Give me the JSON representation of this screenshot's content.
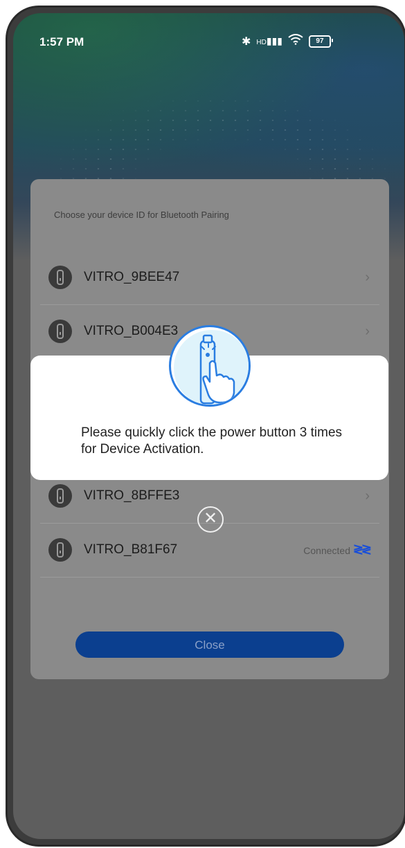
{
  "status_bar": {
    "time": "1:57 PM",
    "bluetooth_icon": "bluetooth-icon",
    "signal_label": "HD",
    "wifi_icon": "wifi-icon",
    "battery_level": "97"
  },
  "sheet": {
    "title": "Choose your device ID for Bluetooth Pairing",
    "devices": [
      {
        "name": "VITRO_9BEE47",
        "status": "",
        "chevron": "›"
      },
      {
        "name": "VITRO_B004E3",
        "status": "",
        "chevron": "›"
      },
      {
        "name": "VITRO_8BFFE3",
        "status": "",
        "chevron": "›"
      },
      {
        "name": "VITRO_B81F67",
        "status": "Connected",
        "chevron": ""
      }
    ],
    "close_label": "Close"
  },
  "modal": {
    "message": "Please quickly click the power button 3 times for Device Activation.",
    "illustration_icon": "hand-pressing-device-icon",
    "dismiss_icon": "close-circle-icon"
  },
  "colors": {
    "accent": "#0b3f8f",
    "illustration_border": "#2a7de1",
    "bluetooth_wave": "#1a4fd8"
  }
}
